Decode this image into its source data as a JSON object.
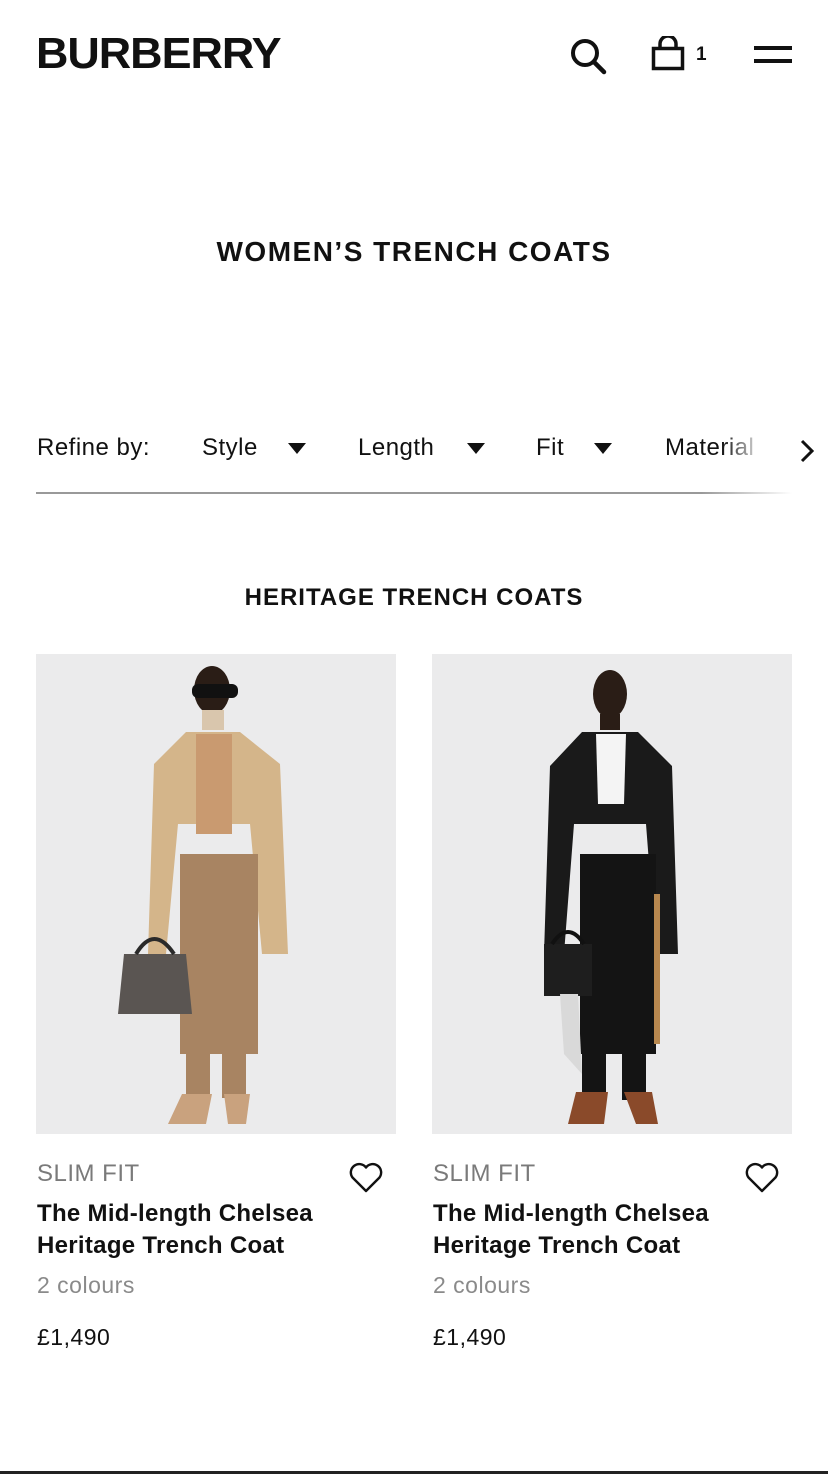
{
  "header": {
    "brand": "BURBERRY",
    "bag_count": "1",
    "icons": {
      "search": "search-icon",
      "bag": "shopping-bag-icon",
      "menu": "hamburger-menu-icon"
    }
  },
  "page_title": "WOMEN’S TRENCH COATS",
  "refine": {
    "label": "Refine by:",
    "filters": [
      "Style",
      "Length",
      "Fit",
      "Material"
    ],
    "next_icon": "chevron-right-icon"
  },
  "section_title": "HERITAGE TRENCH COATS",
  "products": [
    {
      "fit": "SLIM FIT",
      "name": "The Mid-length Chelsea Heritage Trench Coat",
      "colours": "2 colours",
      "price": "£1,490",
      "coat_color": "#d4b58a",
      "wish_icon": "heart-outline-icon"
    },
    {
      "fit": "SLIM FIT",
      "name": "The Mid-length Chelsea Heritage Trench Coat",
      "colours": "2 colours",
      "price": "£1,490",
      "coat_color": "#1a1a1a",
      "wish_icon": "heart-outline-icon"
    }
  ]
}
